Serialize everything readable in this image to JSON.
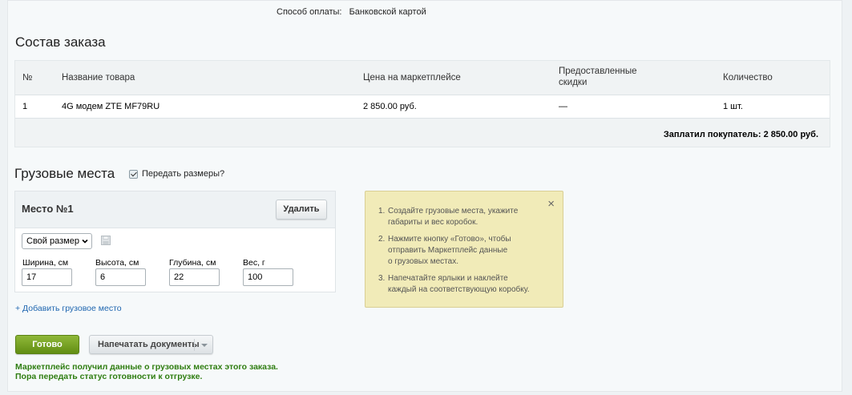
{
  "payment": {
    "label": "Способ оплаты:",
    "value": "Банковской картой"
  },
  "order": {
    "title": "Состав заказа",
    "columns": {
      "num": "№",
      "name": "Название товара",
      "price": "Цена на маркетплейсе",
      "discounts_line1": "Предоставленные",
      "discounts_line2": "скидки",
      "qty": "Количество"
    },
    "rows": [
      {
        "num": "1",
        "name": "4G модем ZTE MF79RU",
        "price": "2 850.00 руб.",
        "discount": "—",
        "qty": "1 шт."
      }
    ],
    "total": "Заплатил покупатель: 2 850.00 руб."
  },
  "cargo": {
    "title": "Грузовые места",
    "pass_sizes_label": "Передать размеры?",
    "pass_sizes_checked": true,
    "place": {
      "title": "Место №1",
      "delete_label": "Удалить",
      "size_select": "Свой размер",
      "fields": [
        {
          "label": "Ширина, см",
          "value": "17"
        },
        {
          "label": "Высота, см",
          "value": "6"
        },
        {
          "label": "Глубина, см",
          "value": "22"
        },
        {
          "label": "Вес, г",
          "value": "100"
        }
      ]
    },
    "add_link": "+ Добавить грузовое место"
  },
  "hint": {
    "close": "×",
    "items": [
      {
        "num": "1.",
        "line1": "Создайте грузовые места, укажите",
        "line2": "габариты и вес коробок.",
        "line3": ""
      },
      {
        "num": "2.",
        "line1": "Нажмите кнопку «Готово», чтобы",
        "line2": "отправить Маркетплейс данные",
        "line3": "о грузовых местах."
      },
      {
        "num": "3.",
        "line1": "Напечатайте ярлыки и наклейте",
        "line2": "каждый на соответствующую коробку.",
        "line3": ""
      }
    ]
  },
  "actions": {
    "done_label": "Готово",
    "print_label": "Напечатать документы"
  },
  "status": {
    "line1": "Маркетплейс получил данные о грузовых местах этого заказа.",
    "line2": "Пора передать статус готовности к отгрузке.",
    "color": "#2e7d10"
  },
  "colors": {
    "accent_green": "#6f9a1c",
    "link": "#2067b0",
    "hint_bg": "#f1ebb8"
  }
}
